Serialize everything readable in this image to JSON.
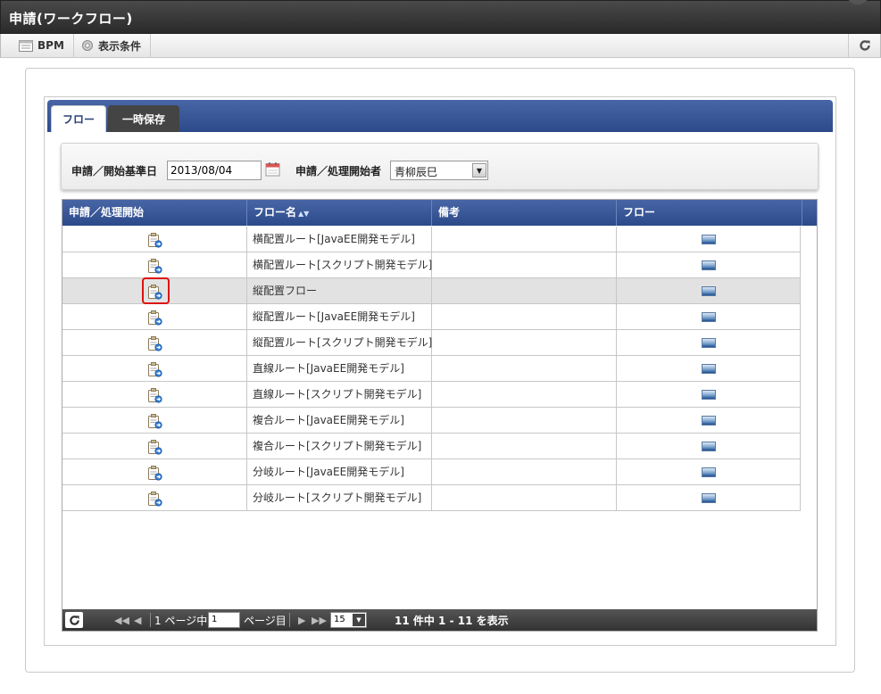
{
  "window": {
    "title": "申請(ワークフロー)"
  },
  "toolbar": {
    "bpm_label": "BPM",
    "conditions_label": "表示条件"
  },
  "tabs": [
    {
      "label": "フロー",
      "active": true
    },
    {
      "label": "一時保存",
      "active": false
    }
  ],
  "search": {
    "date_label": "申請／開始基準日",
    "date_value": "2013/08/04",
    "user_label": "申請／処理開始者",
    "user_value": "青柳辰巳"
  },
  "grid": {
    "headers": [
      "申請／処理開始",
      "フロー名",
      "備考",
      "フロー"
    ],
    "sort_indicator": "▲▼",
    "rows": [
      {
        "name": "横配置ルート[JavaEE開発モデル]",
        "note": ""
      },
      {
        "name": "横配置ルート[スクリプト開発モデル]",
        "note": ""
      },
      {
        "name": "縦配置フロー",
        "note": "",
        "selected": true
      },
      {
        "name": "縦配置ルート[JavaEE開発モデル]",
        "note": ""
      },
      {
        "name": "縦配置ルート[スクリプト開発モデル]",
        "note": ""
      },
      {
        "name": "直線ルート[JavaEE開発モデル]",
        "note": ""
      },
      {
        "name": "直線ルート[スクリプト開発モデル]",
        "note": ""
      },
      {
        "name": "複合ルート[JavaEE開発モデル]",
        "note": ""
      },
      {
        "name": "複合ルート[スクリプト開発モデル]",
        "note": ""
      },
      {
        "name": "分岐ルート[JavaEE開発モデル]",
        "note": ""
      },
      {
        "name": "分岐ルート[スクリプト開発モデル]",
        "note": ""
      }
    ]
  },
  "pager": {
    "page_prefix": "1 ページ中",
    "current_page": "1",
    "page_suffix": "ページ目",
    "page_size": "15",
    "summary": "11 件中 1 - 11 を表示"
  },
  "colors": {
    "header_blue": "#2c4a8a",
    "highlight": "#dd1111"
  }
}
